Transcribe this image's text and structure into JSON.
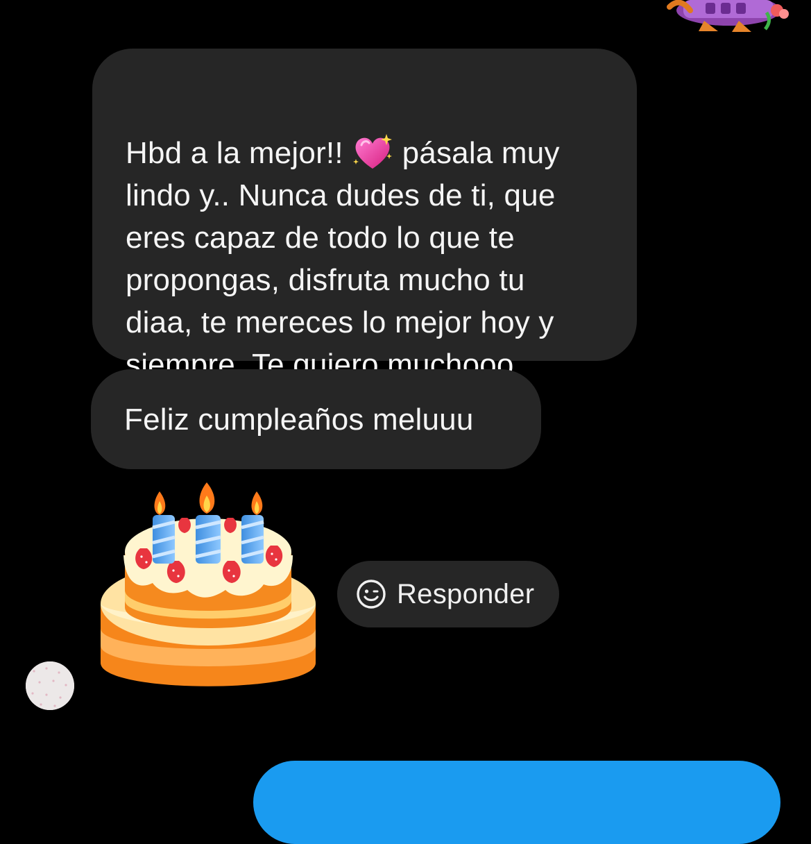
{
  "thread": {
    "message_1_lines": [
      "Hbd a la mejor!! ",
      "lindo y.. Nunca dudes de ti, que",
      "eres capaz de todo lo que te",
      "propongas, disfruta mucho tu",
      "diaa, te mereces lo mejor hoy y",
      "siempre. Te quiero muchooo"
    ],
    "message_1_line1_tail": "pásala muy",
    "message_1_emoji": "sparkling-heart-icon",
    "message_2": "Feliz cumpleaños meluuu",
    "message_3_emoji": "birthday-cake-icon",
    "reply_label": "Responder",
    "colors": {
      "background": "#000000",
      "received_bubble": "#262626",
      "sent_bubble": "#1a9bf0",
      "text": "#f5f5f5"
    }
  }
}
